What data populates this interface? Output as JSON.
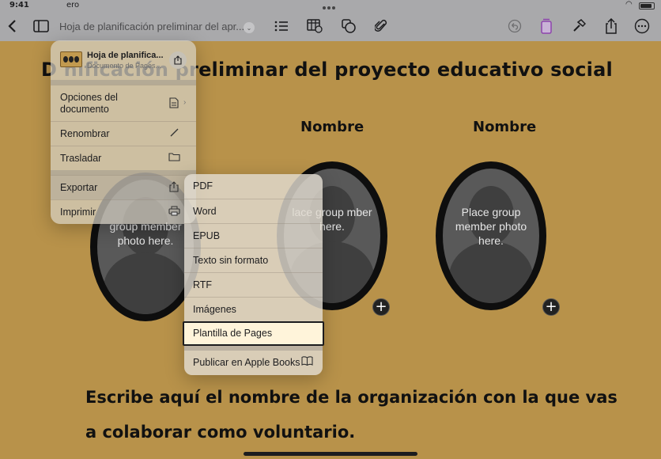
{
  "status_bar": {
    "time": "9:41",
    "date_fragment": "ero"
  },
  "toolbar": {
    "doc_title": "Hoja de planificación preliminar del apr..."
  },
  "document": {
    "title": "D          nificación preliminar del proyecto educativo social",
    "name_label_1": "Nombre",
    "name_label_2": "Nombre",
    "placeholder_text": "Place group member photo here.",
    "placeholder_partial_left": "group member photo here.",
    "placeholder_partial_mid": "lace group mber here.",
    "body_line_1": "Escribe aquí el nombre de la organización con la que vas",
    "body_line_2": "a colaborar como voluntario."
  },
  "menu": {
    "header_title": "Hoja de planifica...",
    "header_subtitle": "Documento de Pages...",
    "items": [
      {
        "label": "Opciones del documento"
      },
      {
        "label": "Renombrar"
      },
      {
        "label": "Trasladar"
      },
      {
        "label": "Exportar"
      },
      {
        "label": "Imprimir"
      }
    ]
  },
  "export_submenu": {
    "items": [
      {
        "label": "PDF"
      },
      {
        "label": "Word"
      },
      {
        "label": "EPUB"
      },
      {
        "label": "Texto sin formato"
      },
      {
        "label": "RTF"
      },
      {
        "label": "Imágenes"
      },
      {
        "label": "Plantilla de Pages"
      }
    ],
    "publish_label": "Publicar en Apple Books",
    "selected": "Plantilla de Pages"
  }
}
